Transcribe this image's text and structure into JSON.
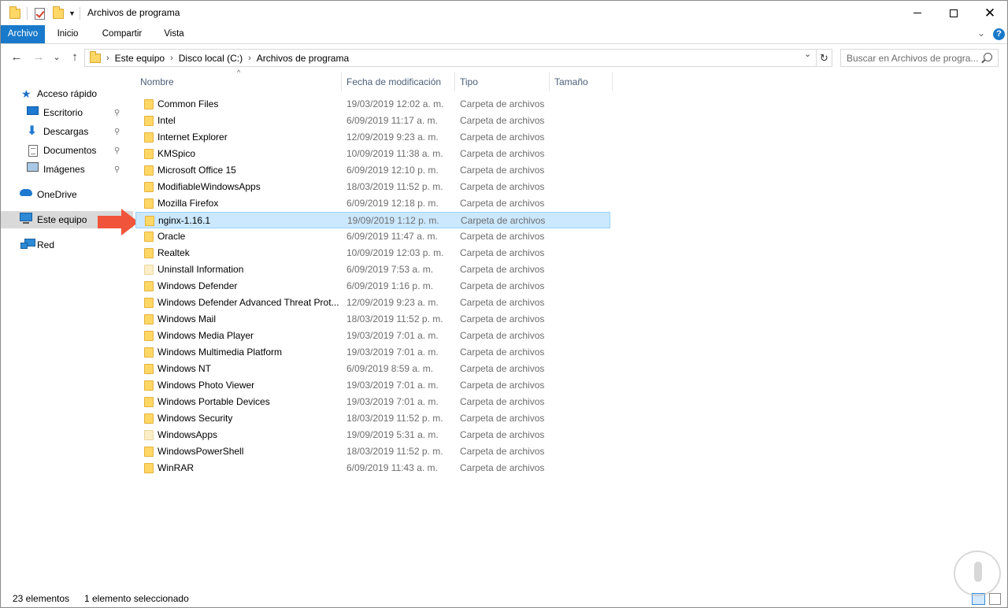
{
  "window": {
    "title": "Archivos de programa",
    "minimize_icon": "minimize-icon",
    "maximize_icon": "maximize-icon",
    "close_icon": "close-icon"
  },
  "ribbon": {
    "tabs": [
      {
        "label": "Archivo",
        "active": true
      },
      {
        "label": "Inicio"
      },
      {
        "label": "Compartir"
      },
      {
        "label": "Vista"
      }
    ],
    "help": "?"
  },
  "nav": {
    "back": "←",
    "forward": "→",
    "recent": "⌄",
    "up": "↑",
    "breadcrumb": [
      "Este equipo",
      "Disco local (C:)",
      "Archivos de programa"
    ],
    "crumb_separator": "›",
    "dropdown": "⌄",
    "refresh": "↻",
    "search_placeholder": "Buscar en Archivos de progra..."
  },
  "sidebar": {
    "items": [
      {
        "label": "Acceso rápido",
        "icon": "star-icon"
      },
      {
        "label": "Escritorio",
        "icon": "desktop-icon",
        "pinned": true
      },
      {
        "label": "Descargas",
        "icon": "download-icon",
        "pinned": true
      },
      {
        "label": "Documentos",
        "icon": "documents-icon",
        "pinned": true
      },
      {
        "label": "Imágenes",
        "icon": "pictures-icon",
        "pinned": true
      },
      {
        "label": "OneDrive",
        "icon": "onedrive-icon"
      },
      {
        "label": "Este equipo",
        "icon": "this-pc-icon",
        "selected": true
      },
      {
        "label": "Red",
        "icon": "network-icon"
      }
    ],
    "pin_glyph": "📌"
  },
  "columns": {
    "name": "Nombre",
    "date": "Fecha de modificación",
    "type": "Tipo",
    "size": "Tamaño",
    "sort_caret": "^"
  },
  "files": [
    {
      "name": "Common Files",
      "date": "19/03/2019 12:02 a. m.",
      "type": "Carpeta de archivos"
    },
    {
      "name": "Intel",
      "date": "6/09/2019 11:17 a. m.",
      "type": "Carpeta de archivos"
    },
    {
      "name": "Internet Explorer",
      "date": "12/09/2019 9:23 a. m.",
      "type": "Carpeta de archivos"
    },
    {
      "name": "KMSpico",
      "date": "10/09/2019 11:38 a. m.",
      "type": "Carpeta de archivos"
    },
    {
      "name": "Microsoft Office 15",
      "date": "6/09/2019 12:10 p. m.",
      "type": "Carpeta de archivos"
    },
    {
      "name": "ModifiableWindowsApps",
      "date": "18/03/2019 11:52 p. m.",
      "type": "Carpeta de archivos"
    },
    {
      "name": "Mozilla Firefox",
      "date": "6/09/2019 12:18 p. m.",
      "type": "Carpeta de archivos"
    },
    {
      "name": "nginx-1.16.1",
      "date": "19/09/2019 1:12 p. m.",
      "type": "Carpeta de archivos",
      "selected": true
    },
    {
      "name": "Oracle",
      "date": "6/09/2019 11:47 a. m.",
      "type": "Carpeta de archivos"
    },
    {
      "name": "Realtek",
      "date": "10/09/2019 12:03 p. m.",
      "type": "Carpeta de archivos"
    },
    {
      "name": "Uninstall Information",
      "date": "6/09/2019 7:53 a. m.",
      "type": "Carpeta de archivos",
      "pale": true
    },
    {
      "name": "Windows Defender",
      "date": "6/09/2019 1:16 p. m.",
      "type": "Carpeta de archivos"
    },
    {
      "name": "Windows Defender Advanced Threat Prot...",
      "date": "12/09/2019 9:23 a. m.",
      "type": "Carpeta de archivos"
    },
    {
      "name": "Windows Mail",
      "date": "18/03/2019 11:52 p. m.",
      "type": "Carpeta de archivos"
    },
    {
      "name": "Windows Media Player",
      "date": "19/03/2019 7:01 a. m.",
      "type": "Carpeta de archivos"
    },
    {
      "name": "Windows Multimedia Platform",
      "date": "19/03/2019 7:01 a. m.",
      "type": "Carpeta de archivos"
    },
    {
      "name": "Windows NT",
      "date": "6/09/2019 8:59 a. m.",
      "type": "Carpeta de archivos"
    },
    {
      "name": "Windows Photo Viewer",
      "date": "19/03/2019 7:01 a. m.",
      "type": "Carpeta de archivos"
    },
    {
      "name": "Windows Portable Devices",
      "date": "19/03/2019 7:01 a. m.",
      "type": "Carpeta de archivos"
    },
    {
      "name": "Windows Security",
      "date": "18/03/2019 11:52 p. m.",
      "type": "Carpeta de archivos"
    },
    {
      "name": "WindowsApps",
      "date": "19/09/2019 5:31 a. m.",
      "type": "Carpeta de archivos",
      "pale": true
    },
    {
      "name": "WindowsPowerShell",
      "date": "18/03/2019 11:52 p. m.",
      "type": "Carpeta de archivos"
    },
    {
      "name": "WinRAR",
      "date": "6/09/2019 11:43 a. m.",
      "type": "Carpeta de archivos"
    }
  ],
  "status": {
    "count": "23 elementos",
    "selection": "1 elemento seleccionado"
  },
  "colors": {
    "accent": "#1979ca",
    "selection_bg": "#cce8ff",
    "selection_border": "#99d1ff",
    "annotation_arrow": "#f0553b"
  }
}
